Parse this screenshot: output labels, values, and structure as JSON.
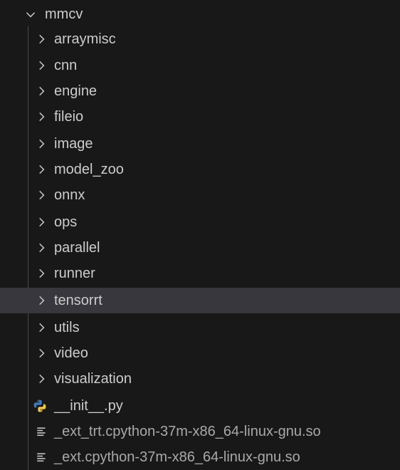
{
  "root": {
    "label": "mmcv",
    "icon": "chevron-down-icon"
  },
  "folders": [
    {
      "label": "arraymisc",
      "icon": "chevron-right-icon"
    },
    {
      "label": "cnn",
      "icon": "chevron-right-icon"
    },
    {
      "label": "engine",
      "icon": "chevron-right-icon"
    },
    {
      "label": "fileio",
      "icon": "chevron-right-icon"
    },
    {
      "label": "image",
      "icon": "chevron-right-icon"
    },
    {
      "label": "model_zoo",
      "icon": "chevron-right-icon"
    },
    {
      "label": "onnx",
      "icon": "chevron-right-icon"
    },
    {
      "label": "ops",
      "icon": "chevron-right-icon"
    },
    {
      "label": "parallel",
      "icon": "chevron-right-icon"
    },
    {
      "label": "runner",
      "icon": "chevron-right-icon"
    },
    {
      "label": "tensorrt",
      "icon": "chevron-right-icon"
    },
    {
      "label": "utils",
      "icon": "chevron-right-icon"
    },
    {
      "label": "video",
      "icon": "chevron-right-icon"
    },
    {
      "label": "visualization",
      "icon": "chevron-right-icon"
    }
  ],
  "files": [
    {
      "label": "__init__.py",
      "icon": "python-icon"
    },
    {
      "label": "_ext_trt.cpython-37m-x86_64-linux-gnu.so",
      "icon": "text-lines-icon"
    },
    {
      "label": "_ext.cpython-37m-x86_64-linux-gnu.so",
      "icon": "text-lines-icon"
    }
  ],
  "hovered_item": "tensorrt",
  "colors": {
    "background": "#181818",
    "hover": "#37373d",
    "text": "#cccccc",
    "chevron": "#c5c5c5",
    "python_blue": "#3d7ab8",
    "python_yellow": "#f2c94c"
  }
}
